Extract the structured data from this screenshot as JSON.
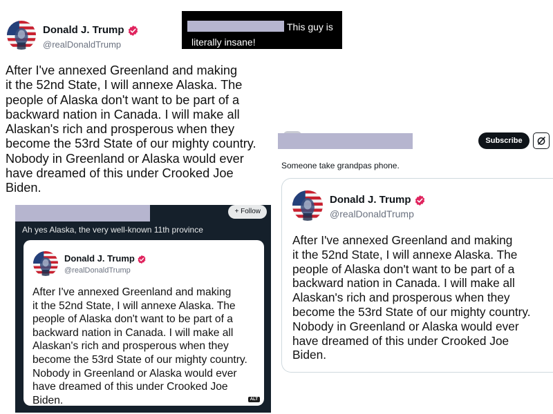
{
  "tweet": {
    "author_name": "Donald J. Trump",
    "author_handle": "@realDonaldTrump",
    "lines": [
      "After I've annexed Greenland and making",
      "it the 52nd State, I will annexe Alaska. The",
      "people of Alaska don't want to be part of a",
      "backward nation in Canada. I will make all",
      "Alaskan's rich and prosperous when they",
      "become the 53rd State of our mighty country.",
      "Nobody in Greenland or Alaska would ever",
      "have dreamed of this under Crooked Joe",
      "Biden."
    ]
  },
  "caption": {
    "line1": "This guy is",
    "line2": "literally insane!"
  },
  "dark_post": {
    "follow_label": "+ Follow",
    "text": "Ah yes Alaska, the very well-known 11th province",
    "alt_badge": "ALT"
  },
  "reply_post": {
    "subscribe_label": "Subscribe",
    "text": "Someone take grandpas phone."
  },
  "icons": {
    "verified": "verified-badge-icon",
    "grok": "grok-icon"
  },
  "colors": {
    "verified_badge": "#e0245e",
    "dark_background": "#15202b",
    "redaction": "#b6b5cf"
  }
}
